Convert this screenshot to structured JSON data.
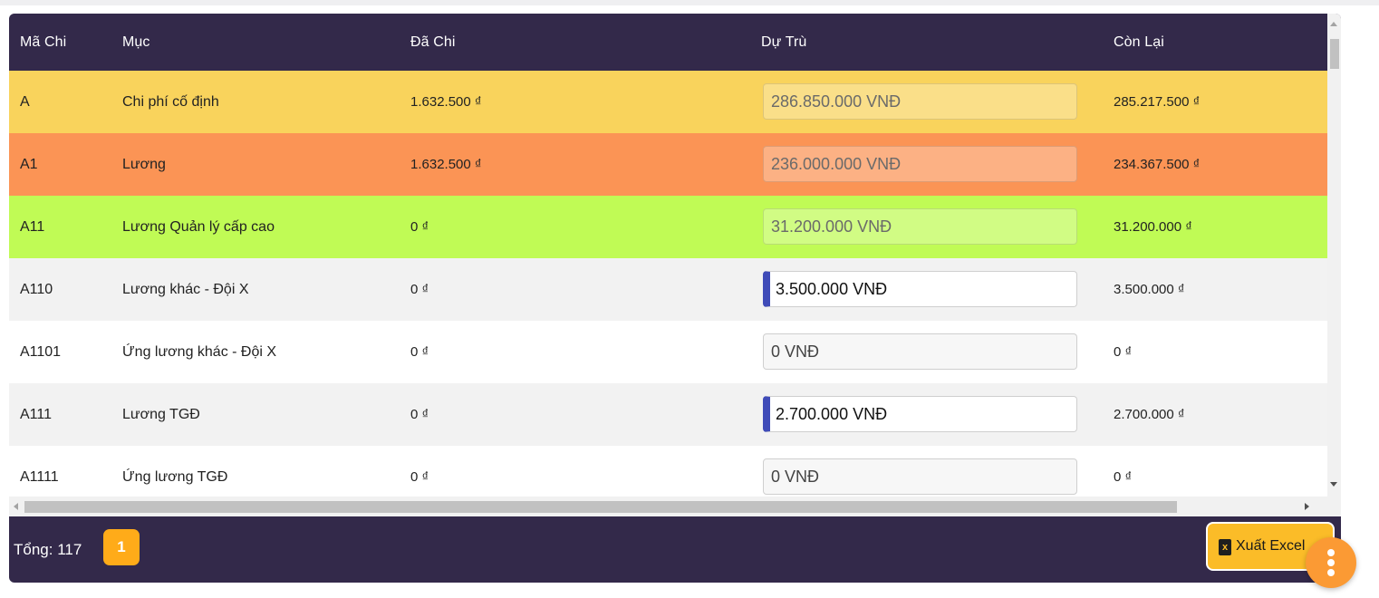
{
  "header": {
    "ma_chi": "Mã Chi",
    "muc": "Mục",
    "da_chi": "Đã Chi",
    "du_tru": "Dự Trù",
    "con_lai": "Còn Lại"
  },
  "rows": [
    {
      "ma": "A",
      "muc": "Chi phí cố định",
      "da_chi": "1.632.500 ₫",
      "du_tru": "286.850.000 VNĐ",
      "con_lai": "285.217.500 ₫",
      "color": "#f9d35c"
    },
    {
      "ma": "A1",
      "muc": "Lương",
      "da_chi": "1.632.500 ₫",
      "du_tru": "236.000.000 VNĐ",
      "con_lai": "234.367.500 ₫",
      "color": "#fb9455"
    },
    {
      "ma": "A11",
      "muc": "Lương Quản lý cấp cao",
      "da_chi": "0 ₫",
      "du_tru": "31.200.000 VNĐ",
      "con_lai": "31.200.000 ₫",
      "color": "#c0fb55"
    },
    {
      "ma": "A110",
      "muc": "Lương khác - Đội X",
      "da_chi": "0 ₫",
      "du_tru": "3.500.000 VNĐ",
      "con_lai": "3.500.000 ₫",
      "color": "#f2f2f2"
    },
    {
      "ma": "A1101",
      "muc": "Ứng lương khác - Đội X",
      "da_chi": "0 ₫",
      "du_tru": "0 VNĐ",
      "con_lai": "0 ₫",
      "color": "#ffffff"
    },
    {
      "ma": "A111",
      "muc": "Lương TGĐ",
      "da_chi": "0 ₫",
      "du_tru": "2.700.000 VNĐ",
      "con_lai": "2.700.000 ₫",
      "color": "#f2f2f2"
    },
    {
      "ma": "A1111",
      "muc": "Ứng lương TGĐ",
      "da_chi": "0 ₫",
      "du_tru": "0 VNĐ",
      "con_lai": "0 ₫",
      "color": "#ffffff"
    }
  ],
  "footer": {
    "total_label": "Tổng: 117",
    "page_number": "1",
    "export_label": "Xuất Excel",
    "export_icon": "file-excel-icon"
  },
  "fab": {
    "icon": "more-vertical-icon"
  },
  "colors": {
    "header_bg": "#33294a",
    "accent_orange": "#ffab19",
    "export_yellow": "#fbbc28",
    "input_focus_bar": "#3f4bb8"
  }
}
